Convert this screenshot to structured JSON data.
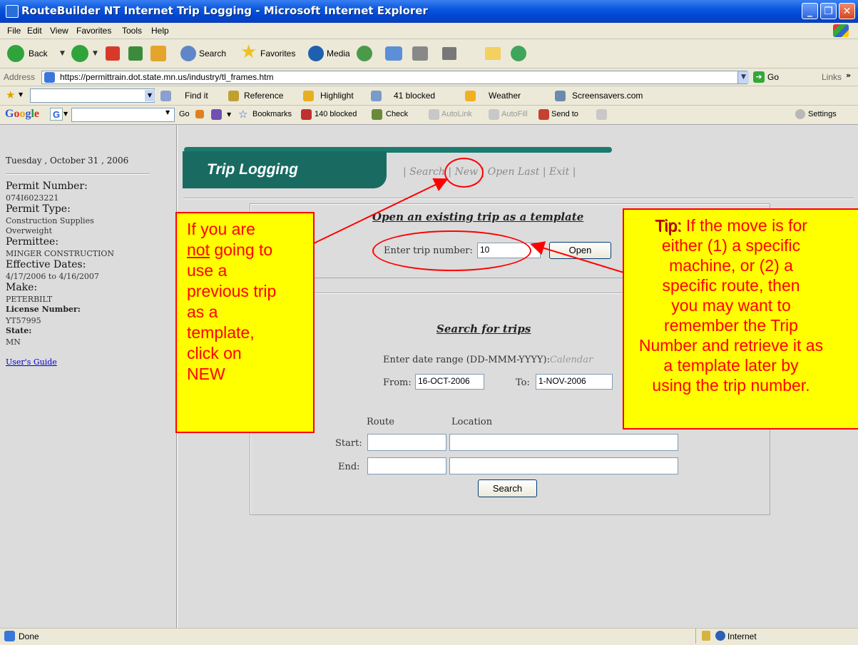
{
  "window": {
    "title": "RouteBuilder NT Internet Trip Logging - Microsoft Internet Explorer",
    "minimize": "_",
    "maximize": "❐",
    "close": "✕"
  },
  "menu": [
    "File",
    "Edit",
    "View",
    "Favorites",
    "Tools",
    "Help"
  ],
  "toolbar": {
    "back": "Back",
    "search": "Search",
    "favorites": "Favorites",
    "media": "Media"
  },
  "address": {
    "label": "Address",
    "url": "https://permittrain.dot.state.mn.us/industry/tl_frames.htm",
    "go": "Go",
    "links": "Links"
  },
  "links_bar": {
    "find_it": "Find it",
    "reference": "Reference",
    "highlight": "Highlight",
    "blocked": "41 blocked",
    "weather": "Weather",
    "screensavers": "Screensavers.com"
  },
  "google_bar": {
    "logo": "Google",
    "go": "Go",
    "bookmarks": "Bookmarks",
    "blocked": "140 blocked",
    "check": "Check",
    "autolink": "AutoLink",
    "autofill": "AutoFill",
    "send_to": "Send to",
    "settings": "Settings"
  },
  "left_panel": {
    "date": "Tuesday , October 31 , 2006",
    "permit_number_label": "Permit Number:",
    "permit_number": "074I6023221",
    "permit_type_label": "Permit Type:",
    "permit_type_1": "Construction Supplies",
    "permit_type_2": "Overweight",
    "permittee_label": "Permittee:",
    "permittee": "MINGER CONSTRUCTION",
    "effective_dates_label": "Effective Dates:",
    "effective_dates": "4/17/2006 to 4/16/2007",
    "make_label": "Make:",
    "make": "PETERBILT",
    "license_number_label": "License Number:",
    "license_number": "YT57995",
    "state_label": "State:",
    "state": "MN",
    "users_guide": "User's Guide"
  },
  "trip_logging": {
    "title": "Trip Logging",
    "nav_sep": "|",
    "nav_search": "Search",
    "nav_new": "New",
    "nav_open_last": "Open Last",
    "nav_exit": "Exit"
  },
  "open_form": {
    "heading": "Open an existing trip as a template",
    "label": "Enter trip number:",
    "value": "10",
    "button": "Open"
  },
  "search_form": {
    "heading": "Search for trips",
    "date_range_label": "Enter date range (DD-MMM-YYYY):",
    "calendar": "Calendar",
    "from_label": "From:",
    "from_value": "16-OCT-2006",
    "to_label": "To:",
    "to_value": "1-NOV-2006",
    "route_header": "Route",
    "location_header": "Location",
    "start_label": "Start:",
    "end_label": "End:",
    "button": "Search"
  },
  "callout_left": {
    "line1": "If you are",
    "line2_underlined": "not",
    "line2_rest": " going to",
    "line3": "use a",
    "line4": "previous trip",
    "line5": "as a",
    "line6": "template,",
    "line7": "click on",
    "line8": "NEW"
  },
  "callout_right": {
    "tip": "Tip:",
    "line1": " If the move is for",
    "line2": "either (1) a specific",
    "line3": "machine, or (2) a",
    "line4": "specific route, then",
    "line5": "you may want to",
    "line6": "remember the Trip",
    "line7": "Number and retrieve it as",
    "line8": "a template later by",
    "line9": "using the trip number."
  },
  "status": {
    "text": "Done",
    "zone": "Internet"
  },
  "colors": {
    "accent_teal": "#196b62",
    "callout_fill": "#ffff00",
    "callout_red": "#ff0000"
  }
}
